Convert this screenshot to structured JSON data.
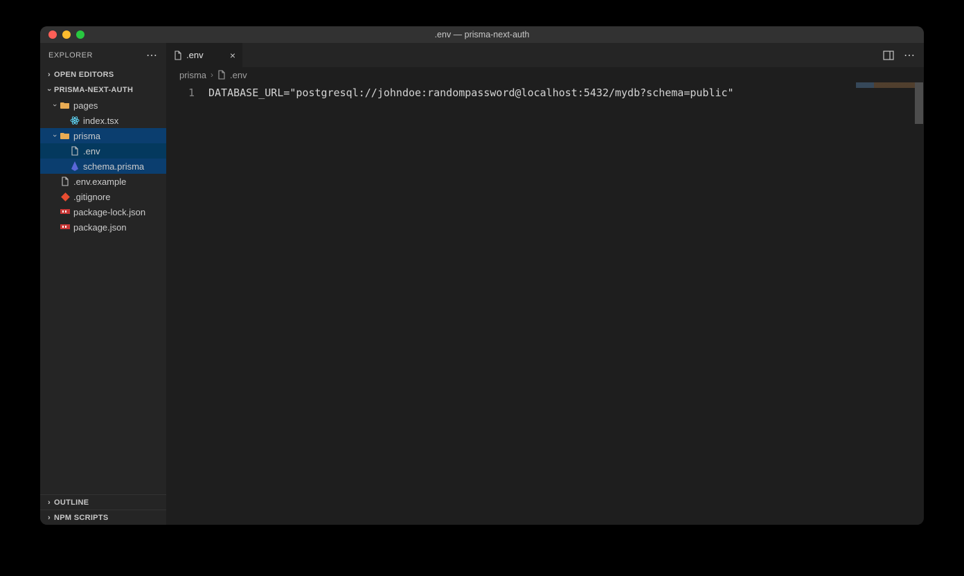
{
  "window": {
    "title": ".env — prisma-next-auth"
  },
  "sidebar": {
    "title": "EXPLORER",
    "sections": {
      "open_editors": "OPEN EDITORS",
      "project": "PRISMA-NEXT-AUTH",
      "outline": "OUTLINE",
      "npm_scripts": "NPM SCRIPTS"
    },
    "tree": {
      "pages": {
        "label": "pages",
        "children": {
          "index": "index.tsx"
        }
      },
      "prisma": {
        "label": "prisma",
        "children": {
          "env": ".env",
          "schema": "schema.prisma"
        }
      },
      "env_example": ".env.example",
      "gitignore": ".gitignore",
      "package_lock": "package-lock.json",
      "package": "package.json"
    }
  },
  "tabs": {
    "active": {
      "label": ".env"
    }
  },
  "breadcrumbs": {
    "folder": "prisma",
    "file": ".env"
  },
  "editor": {
    "gutter": {
      "line1": "1"
    },
    "content": "DATABASE_URL=\"postgresql://johndoe:randompassword@localhost:5432/mydb?schema=public\""
  }
}
